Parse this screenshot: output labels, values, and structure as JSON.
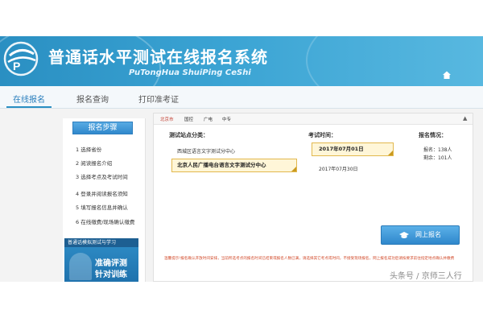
{
  "header": {
    "title": "普通话水平测试在线报名系统",
    "subtitle": "PuTongHua ShuiPing CeShi"
  },
  "nav": {
    "tabs": [
      {
        "label": "在线报名",
        "active": true
      },
      {
        "label": "报名查询",
        "active": false
      },
      {
        "label": "打印准考证",
        "active": false
      }
    ]
  },
  "sidebar": {
    "steps_title": "报名步骤",
    "steps": [
      "1 选择省份",
      "2 阅读报名介绍",
      "3 选择考点及考试时间",
      "4 登录并阅读报名须知",
      "5 填写报名信息并确认",
      "6 在线缴费/现场确认缴费"
    ],
    "ad": {
      "top": "普通话模拟测试与学习",
      "line1": "准确评测",
      "line2": "针对训练"
    }
  },
  "main": {
    "city_tabs": [
      {
        "label": "北京市",
        "active": true
      },
      {
        "label": "国控",
        "active": false
      },
      {
        "label": "广电",
        "active": false
      },
      {
        "label": "中专",
        "active": false
      }
    ],
    "centers_header": "测试站点分类：",
    "centers": [
      "西城区语言文字测试分中心",
      "北京人民广播电台语言文字测试分中心"
    ],
    "selected_center": "北京人民广播电台语言文字测试分中心",
    "dates_header": "考试时间：",
    "selected_date": "2017年07月01日",
    "other_date": "2017年07月30日",
    "status_header": "报名情况：",
    "registered": "报名：138人",
    "remaining": "剩余：101人",
    "signup_label": "网上报名",
    "notice": "温馨提示!报名确认开放时间安排，当前所选考点的报名时间已结束或报名人数已满，请选择其它考点或时间，不接受现场报名，网上报名成功后请按要求前往指定地点确认并缴费"
  },
  "watermark": "头条号 / 京师三人行",
  "colors": {
    "header_blue": "#2a8fc2",
    "accent_red": "#c0392b",
    "selected_bg": "#fff6d8",
    "button_blue": "#2f87cc"
  }
}
